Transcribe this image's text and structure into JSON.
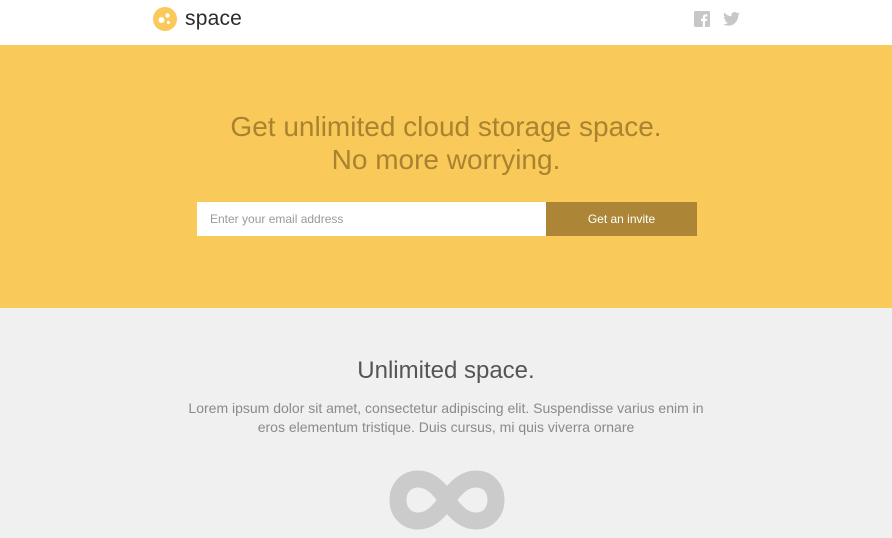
{
  "header": {
    "brand_name": "space",
    "logo_icon": "space-logo-icon",
    "social": [
      {
        "name": "facebook-icon"
      },
      {
        "name": "twitter-icon"
      }
    ]
  },
  "hero": {
    "title_line1": "Get unlimited cloud storage space.",
    "title_line2": "No more worrying.",
    "email_placeholder": "Enter your email address",
    "email_value": "",
    "invite_label": "Get an invite"
  },
  "features": {
    "title": "Unlimited space.",
    "description": "Lorem ipsum dolor sit amet, consectetur adipiscing elit. Suspendisse varius enim in eros elementum tristique. Duis cursus, mi quis viverra ornare",
    "icon": "infinity-icon"
  },
  "colors": {
    "hero_background": "#f9c959",
    "hero_text": "#a98330",
    "button": "#ac8636",
    "features_background": "#f0f0f0"
  }
}
